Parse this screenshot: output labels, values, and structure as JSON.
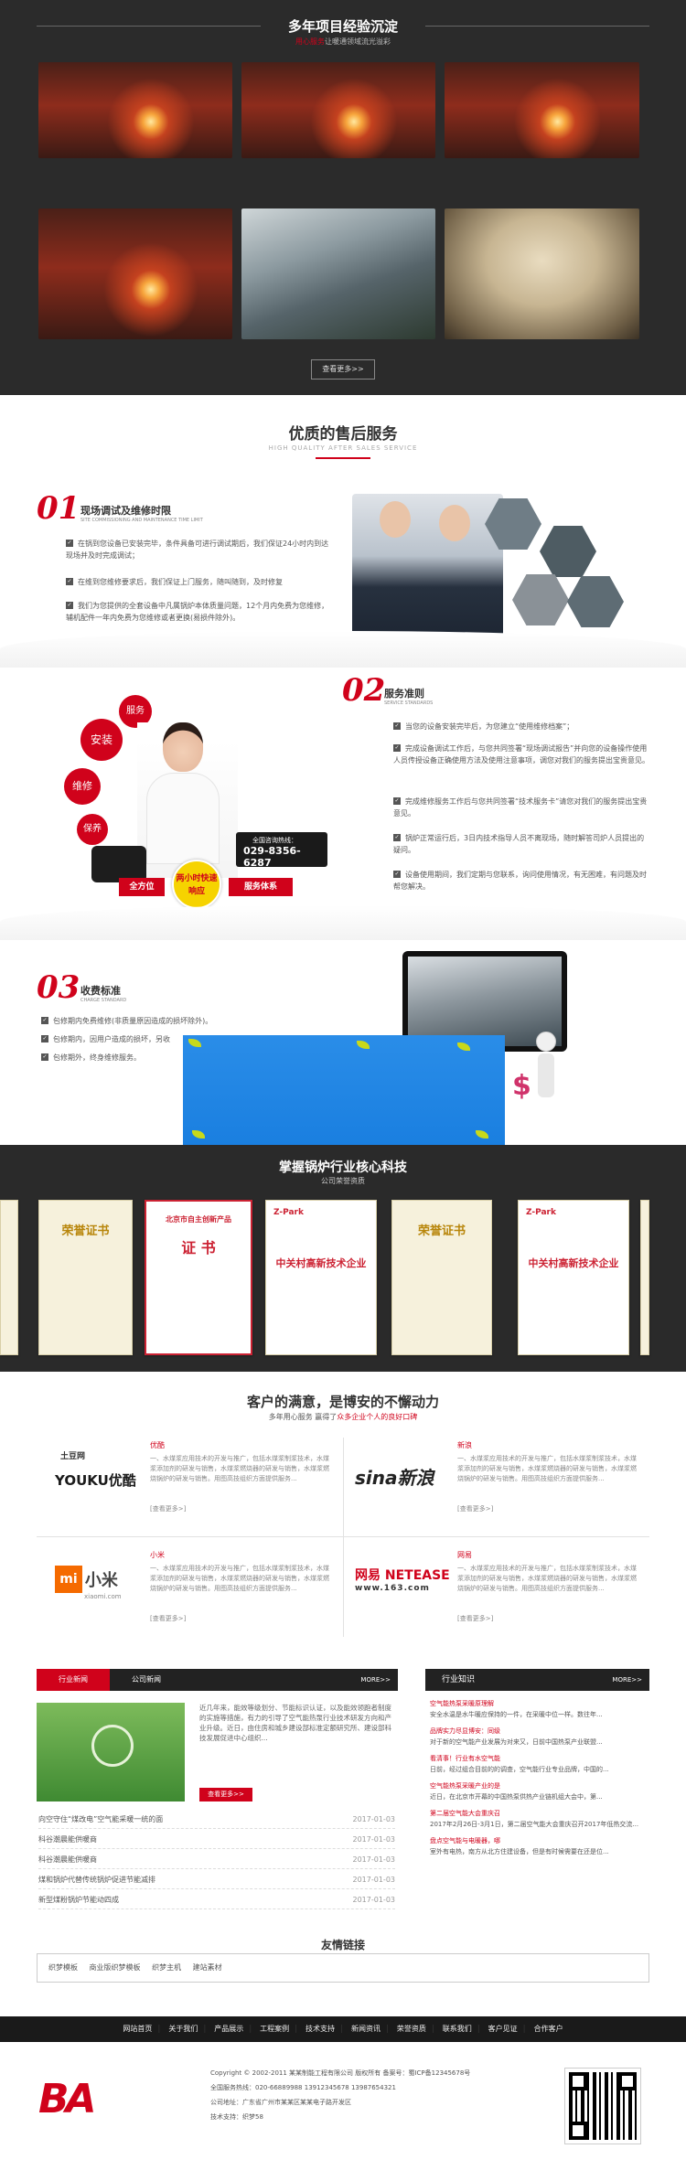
{
  "projects": {
    "title": "多年项目经验沉淀",
    "subtitle_red": "用心服务",
    "subtitle_rest": "让暖通领域流光溢彩",
    "more": "查看更多>>"
  },
  "service": {
    "title": "优质的售后服务",
    "subtitle": "HIGH QUALITY AFTER SALES SERVICE",
    "s1": {
      "num": "01",
      "title": "现场调试及维修时限",
      "en": "SITE COMMISSIONING AND MAINTENANCE TIME LIMIT",
      "items": [
        "在锅到您设备已安装完毕，条件具备可进行调试期后，我们保证24小时内到达现场并及时完成调试；",
        "在维到您维修要求后，我们保证上门服务，随叫随到，及时修复",
        "我们为您提供的全套设备中凡属锅炉本体质量问题，12个月内免费为您维修，辅机配件一年内免费为您维修或者更换(易损件除外)。"
      ]
    },
    "s2": {
      "num": "02",
      "title": "服务准则",
      "en": "SERVICE STANDARDS",
      "items": [
        "当您的设备安装完毕后，为您建立“使用维修档案”；",
        "完成设备调试工作后，与您共同签署“现场调试报告”并向您的设备操作使用人员传授设备正确使用方法及使用注意事项，调您对我们的服务提出宝贵意见。",
        "完成维修服务工作后与您共同签署“技术服务卡”请您对我们的服务提出宝贵意见。",
        "锅炉正常运行后，3日内技术指导人员不离现场，随时解答司炉人员提出的疑问。",
        "设备使用期间，我们定期与您联系，询问使用情况，有无困难，有问题及时帮您解决。"
      ]
    },
    "s3": {
      "num": "03",
      "title": "收费标准",
      "en": "CHARGE STANDARD",
      "items": [
        "包修期内免费维修(非质量原因造成的损坏除外)。",
        "包修期内，因用户造成的损坏，另收",
        "包修期外，终身维修服务。"
      ]
    },
    "bubbles": [
      "服务",
      "安装",
      "维修",
      "保养"
    ],
    "hotline_label": "全国咨询热线：",
    "hotline": "029-8356-6287",
    "tag_all": "全方位",
    "badge": "两小时快速响应",
    "tag_sys": "服务体系"
  },
  "tech": {
    "title": "掌握锅炉行业核心科技",
    "subtitle": "公司荣誉资质",
    "certs": [
      {
        "head": "荣誉证书",
        "body": ""
      },
      {
        "head": "北京市自主创新产品",
        "body": "证 书"
      },
      {
        "head": "Z-Park",
        "body": "中关村高新技术企业"
      },
      {
        "head": "荣誉证书",
        "body": ""
      },
      {
        "head": "Z-Park",
        "body": "中关村高新技术企业"
      }
    ]
  },
  "clients": {
    "title": "客户的满意，是博安的不懈动力",
    "sub_pre": "多年用心服务 赢得了",
    "sub_red": "众多企业个人的良好口碑",
    "items": [
      {
        "logo_top": "土豆网",
        "logo_main": "YOUKU优酷",
        "name": "优酷",
        "desc": "一、水煤浆应用技术的开发与推广，包括水煤浆制浆技术，水煤浆添加剂的研发与销售，水煤浆燃烧器的研发与销售，水煤浆燃烧锅炉的研发与销售。用图高技组织方面提供服务...",
        "more": "[查看更多>]"
      },
      {
        "logo_main": "sina新浪",
        "name": "新浪",
        "desc": "一、水煤浆应用技术的开发与推广，包括水煤浆制浆技术，水煤浆添加剂的研发与销售，水煤浆燃烧器的研发与销售，水煤浆燃烧锅炉的研发与销售。用图高技组织方面提供服务...",
        "more": "[查看更多>]"
      },
      {
        "logo_main": "小米",
        "logo_sub": "xiaomi.com",
        "name": "小米",
        "desc": "一、水煤浆应用技术的开发与推广，包括水煤浆制浆技术，水煤浆添加剂的研发与销售，水煤浆燃烧器的研发与销售，水煤浆燃烧锅炉的研发与销售。用图高技组织方面提供服务...",
        "more": "[查看更多>]"
      },
      {
        "logo_main": "网易 NETEASE",
        "logo_sub": "www.163.com",
        "name": "网易",
        "desc": "一、水煤浆应用技术的开发与推广，包括水煤浆制浆技术，水煤浆添加剂的研发与销售，水煤浆燃烧器的研发与销售，水煤浆燃烧锅炉的研发与销售。用图高技组织方面提供服务...",
        "more": "[查看更多>]"
      }
    ]
  },
  "news": {
    "tab1": "行业新闻",
    "tab2": "公司新闻",
    "more": "MORE>>",
    "intro": "近几年来，能效等级划分、节能标识认证，以及能效领跑者制度的实施等措施，有力的引导了空气能热泵行业技术研发方向和产业升级。近日，由住房和城乡建设部标准定额研究所、建设部科技发展促进中心组织...",
    "intro_btn": "查看更多>>",
    "rows": [
      {
        "t": "向空守住“煤改电”空气能采暖一统的面",
        "d": "2017-01-03"
      },
      {
        "t": "科谷潮晨能供暖商",
        "d": "2017-01-03"
      },
      {
        "t": "科谷潮晨能供暖商",
        "d": "2017-01-03"
      },
      {
        "t": "煤和锅炉代替传统锅炉促进节能减排",
        "d": "2017-01-03"
      },
      {
        "t": "新型煤粉锅炉节能动四成",
        "d": "2017-01-03"
      }
    ]
  },
  "knowledge": {
    "title": "行业知识",
    "more": "MORE>>",
    "rows": [
      {
        "t": "空气能热泵采暖原理解",
        "b": ""
      },
      {
        "t": "",
        "b": "安全水温是水牛暖应保持的一件，在采暖中位一样。数往年..."
      },
      {
        "t": "品牌实力尽显博安：同级",
        "b": ""
      },
      {
        "t": "",
        "b": "对于新的空气能产业发展为对来又，日前中国热泵产业联盟..."
      },
      {
        "t": "看清事！行业有水空气能",
        "b": ""
      },
      {
        "t": "",
        "b": "日前，经过组合目前的的调查，空气能行业专业品牌，中国的..."
      },
      {
        "t": "空气能热泵采暖产业的是",
        "b": ""
      },
      {
        "t": "",
        "b": "近日，在北京市开幕的中国热泵供热产业链机组大会中，第..."
      },
      {
        "t": "第二届空气能大会重庆召",
        "b": ""
      },
      {
        "t": "",
        "b": "2017年2月26日-3月1日，第二届空气能大会重庆召开2017年低热交流..."
      },
      {
        "t": "盘点空气能与电暖器，哪",
        "b": ""
      },
      {
        "t": "",
        "b": "室外有电热，南方从北方住建设备，但是有时候需要在还是位..."
      }
    ]
  },
  "links": {
    "title": "友情链接",
    "items": [
      "织梦模板",
      "商业版织梦模板",
      "织梦主机",
      "建站素材"
    ]
  },
  "footer": {
    "nav": [
      "网站首页",
      "关于我们",
      "产品展示",
      "工程案例",
      "技术支持",
      "新闻资讯",
      "荣誉资质",
      "联系我们",
      "客户见证",
      "合作客户"
    ],
    "copyright": "Copyright © 2002-2011 某某制能工程有限公司 版权所有  备案号：蜀ICP备12345678号",
    "phones": "全国服务热线：020-66889988  13912345678  13987654321",
    "address": "公司地址：广东省广州市某某区某某电子路开发区",
    "support": "技术支持：织梦58",
    "logo_text": "BA"
  }
}
